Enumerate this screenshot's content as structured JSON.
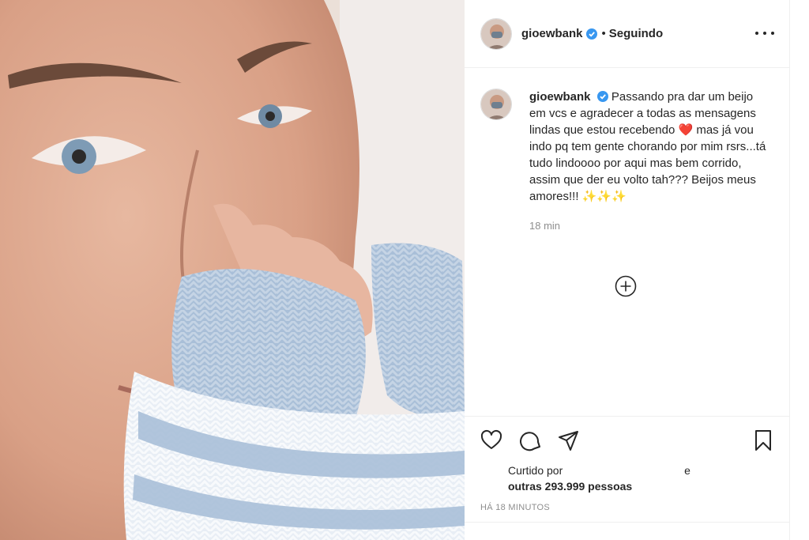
{
  "post": {
    "username": "gioewbank",
    "follow_separator": "•",
    "follow_status": "Seguindo",
    "caption_text": "Passando pra dar um beijo em vcs e agradecer a todas as mensagens lindas que estou recebendo ❤️ mas já vou indo pq tem gente chorando por mim rsrs...tá tudo lindoooo por aqui mas bem corrido, assim que der eu volto tah??? Beijos meus amores!!! ✨✨✨",
    "relative_time": "18 min",
    "liked_by_label": "Curtido por",
    "liked_and": "e",
    "liked_others": "outras 293.999 pessoas",
    "posted_ago": "HÁ 18 MINUTOS"
  },
  "icons": {
    "verified": "verified-badge-icon",
    "more": "more-options-icon",
    "add_comment": "plus-circle-icon",
    "like": "heart-icon",
    "comment": "comment-icon",
    "share": "share-icon",
    "save": "bookmark-icon"
  },
  "colors": {
    "verified_blue": "#3897f0",
    "text": "#262626",
    "muted": "#8e8e8e",
    "divider": "#efefef"
  }
}
